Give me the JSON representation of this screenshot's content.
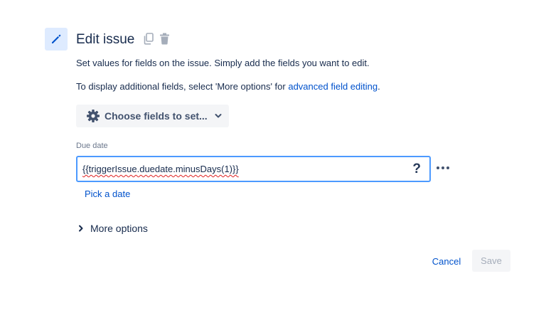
{
  "header": {
    "title": "Edit issue",
    "icon": "pencil-icon"
  },
  "description": {
    "line1": "Set values for fields on the issue. Simply add the fields you want to edit.",
    "line2_prefix": "To display additional fields, select 'More options' for ",
    "line2_link": "advanced field editing",
    "line2_suffix": "."
  },
  "choose_fields": {
    "label": "Choose fields to set..."
  },
  "field": {
    "label": "Due date",
    "value": "{{triggerIssue.duedate.minusDays(1)}}",
    "help": "?",
    "pick_date": "Pick a date"
  },
  "more_options": {
    "label": "More options"
  },
  "footer": {
    "cancel_label": "Cancel",
    "save_label": "Save"
  },
  "colors": {
    "accent": "#0052cc",
    "focus_border": "#4c9aff",
    "icon_bg": "#deebff"
  }
}
